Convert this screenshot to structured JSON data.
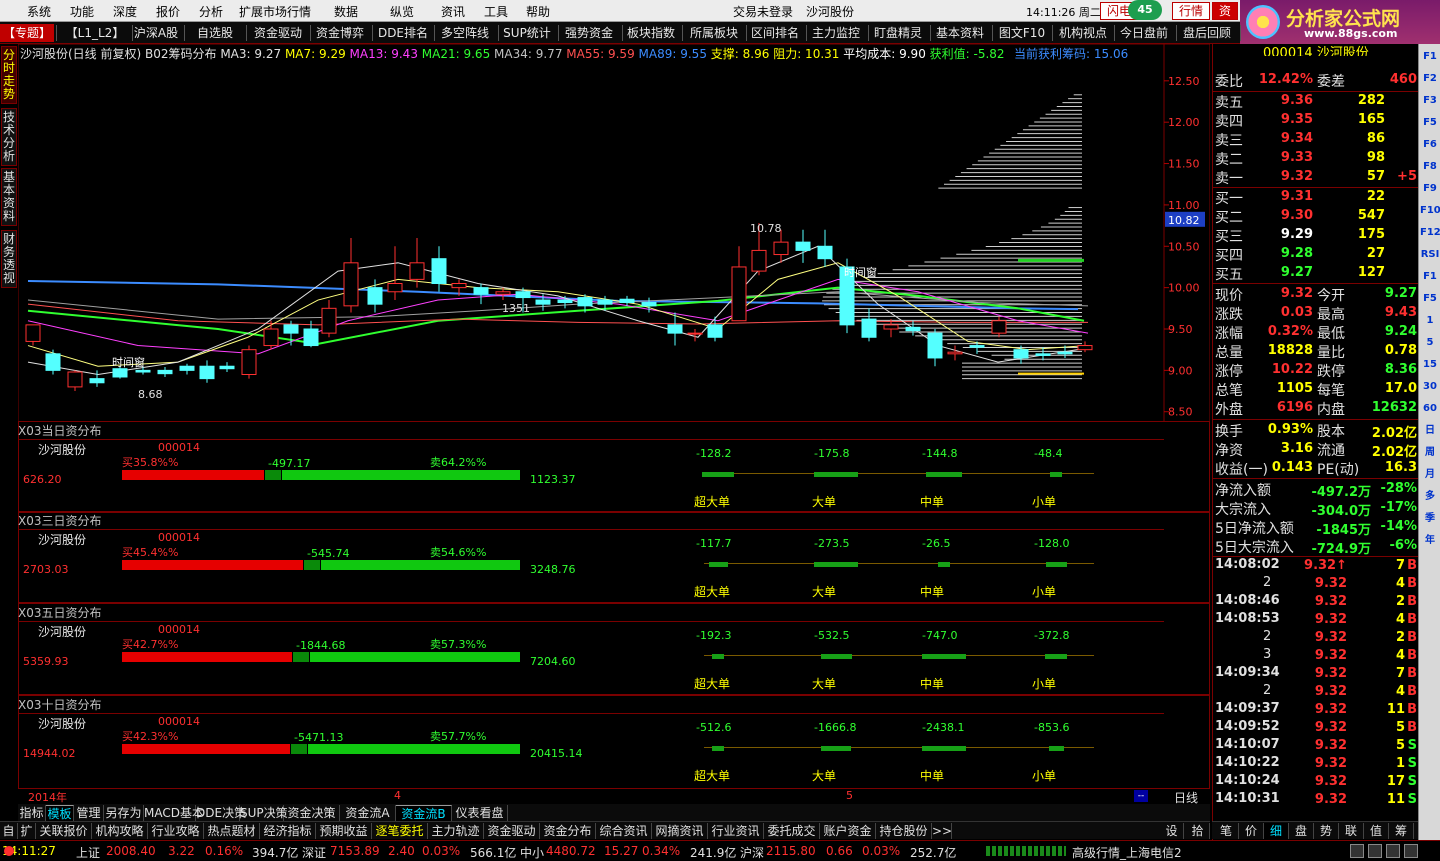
{
  "menu": {
    "items": [
      "系统",
      "功能",
      "深度",
      "报价",
      "分析",
      "扩展市场行情",
      "数据",
      "纵览",
      "资讯",
      "工具",
      "帮助"
    ],
    "login": "交易未登录",
    "stock": "沙河股份",
    "time": "14:11:26 周二",
    "btn_flash": "闪电",
    "badge": "45",
    "btn_quote": "行情",
    "btn_trade": "资"
  },
  "logo": {
    "t1": "分析家公式网",
    "t2": "www.88gs.com"
  },
  "toolbar": {
    "items": [
      "【专题】",
      "【L1_L2】",
      "沪深A股",
      "自选股",
      "资金驱动",
      "资金博弈",
      "DDE排名",
      "多空阵线",
      "SUP统计",
      "强势资金",
      "板块指数",
      "所属板块",
      "区间排名",
      "主力监控",
      "盯盘精灵",
      "基本资料",
      "图文F10",
      "机构视点",
      "今日盘前",
      "盘后回顾"
    ]
  },
  "vtabs": [
    "分时走势",
    "技术分析",
    "基本资料",
    "财务透视"
  ],
  "chart_header": {
    "name": "沙河股份(日线 前复权) B02筹码分布",
    "ma3": "MA3: 9.27",
    "ma7": "MA7: 9.29",
    "ma13": "MA13: 9.43",
    "ma21": "MA21: 9.65",
    "ma34": "MA34: 9.77",
    "ma55": "MA55: 9.59",
    "ma89": "MA89: 9.55",
    "support": "支撑: 8.96",
    "resist": "阻力: 10.31",
    "avgcost": "平均成本: 9.90",
    "profit": "获利值: -5.82",
    "cur_profit": "当前获利筹码: 15.06"
  },
  "chart_labels": {
    "high": "10.78",
    "low": "8.68",
    "mid": "1351",
    "window1": "时间窗",
    "window2": "时间窗",
    "price_tag": "10.82"
  },
  "chart_data": {
    "type": "candlestick",
    "y_ticks": [
      12.5,
      12.0,
      11.5,
      11.0,
      10.5,
      10.0,
      9.5,
      9.0,
      8.5
    ],
    "y_tick_labels": [
      "12.50",
      "12.00",
      "11.50",
      "11.00",
      "10.50",
      "10.00",
      "9.50",
      "9.00",
      "8.50"
    ],
    "ylim": [
      8.4,
      12.8
    ],
    "x_labels": [
      "2014年",
      "4",
      "5",
      "日线"
    ]
  },
  "sections": [
    {
      "title": "X03当日资分布",
      "name": "沙河股份",
      "code": "000014",
      "buy_pct": "买35.8%%",
      "sell_pct": "卖64.2%%",
      "net": "-497.17",
      "left": "626.20",
      "right": "1123.37",
      "buy_frac": 0.358,
      "cat_vals": [
        "-128.2",
        "-175.8",
        "-144.8",
        "-48.4"
      ],
      "cat_labels": [
        "超大单",
        "大单",
        "中单",
        "小单"
      ]
    },
    {
      "title": "X03三日资分布",
      "name": "沙河股份",
      "code": "000014",
      "buy_pct": "买45.4%%",
      "sell_pct": "卖54.6%%",
      "net": "-545.74",
      "left": "2703.03",
      "right": "3248.76",
      "buy_frac": 0.454,
      "cat_vals": [
        "-117.7",
        "-273.5",
        "-26.5",
        "-128.0"
      ],
      "cat_labels": [
        "超大单",
        "大单",
        "中单",
        "小单"
      ]
    },
    {
      "title": "X03五日资分布",
      "name": "沙河股份",
      "code": "000014",
      "buy_pct": "买42.7%%",
      "sell_pct": "卖57.3%%",
      "net": "-1844.68",
      "left": "5359.93",
      "right": "7204.60",
      "buy_frac": 0.427,
      "cat_vals": [
        "-192.3",
        "-532.5",
        "-747.0",
        "-372.8"
      ],
      "cat_labels": [
        "超大单",
        "大单",
        "中单",
        "小单"
      ]
    },
    {
      "title": "X03十日资分布",
      "name": "沙河股份",
      "code": "000014",
      "buy_pct": "买42.3%%",
      "sell_pct": "卖57.7%%",
      "net": "-5471.13",
      "left": "14944.02",
      "right": "20415.14",
      "buy_frac": 0.423,
      "cat_vals": [
        "-512.6",
        "-1666.8",
        "-2438.1",
        "-853.6"
      ],
      "cat_labels": [
        "超大单",
        "大单",
        "中单",
        "小单"
      ]
    }
  ],
  "tabs1": [
    "指标",
    "模板",
    "管理",
    "另存为",
    "MACD基本",
    "DDE决策",
    "SUP决策",
    "资金决策",
    "资金流A",
    "资金流B",
    "仪表看盘"
  ],
  "tabs2": [
    "自",
    "扩",
    "关联报价",
    "机构攻略",
    "行业攻略",
    "热点题材",
    "经济指标",
    "预期收益",
    "逐笔委托",
    "主力轨迹",
    "资金驱动",
    "资金分布",
    "综合资讯",
    "网摘资讯",
    "行业资讯",
    "委托成交",
    "账户资金",
    "持仓股份",
    ">>",
    "设",
    "拾"
  ],
  "right": {
    "header": "000014 沙河股份",
    "ratio": {
      "l1": "委比",
      "v1": "12.42%",
      "l2": "委差",
      "v2": "460"
    },
    "sells": [
      {
        "l": "卖五",
        "p": "9.36",
        "v": "282"
      },
      {
        "l": "卖四",
        "p": "9.35",
        "v": "165"
      },
      {
        "l": "卖三",
        "p": "9.34",
        "v": "86"
      },
      {
        "l": "卖二",
        "p": "9.33",
        "v": "98"
      },
      {
        "l": "卖一",
        "p": "9.32",
        "v": "57",
        "x": "+5"
      }
    ],
    "buys": [
      {
        "l": "买一",
        "p": "9.31",
        "v": "22"
      },
      {
        "l": "买二",
        "p": "9.30",
        "v": "547"
      },
      {
        "l": "买三",
        "p": "9.29",
        "v": "175"
      },
      {
        "l": "买四",
        "p": "9.28",
        "v": "27"
      },
      {
        "l": "买五",
        "p": "9.27",
        "v": "127"
      }
    ],
    "stats": [
      {
        "l1": "现价",
        "v1": "9.32",
        "l2": "今开",
        "v2": "9.27"
      },
      {
        "l1": "涨跌",
        "v1": "0.03",
        "l2": "最高",
        "v2": "9.43"
      },
      {
        "l1": "涨幅",
        "v1": "0.32%",
        "l2": "最低",
        "v2": "9.24"
      },
      {
        "l1": "总量",
        "v1": "18828",
        "l2": "量比",
        "v2": "0.78"
      },
      {
        "l1": "涨停",
        "v1": "10.22",
        "l2": "跌停",
        "v2": "8.36"
      },
      {
        "l1": "总笔",
        "v1": "1105",
        "l2": "每笔",
        "v2": "17.0"
      },
      {
        "l1": "外盘",
        "v1": "6196",
        "l2": "内盘",
        "v2": "12632"
      }
    ],
    "stats2": [
      {
        "l1": "换手",
        "v1": "0.93%",
        "l2": "股本",
        "v2": "2.02亿"
      },
      {
        "l1": "净资",
        "v1": "3.16",
        "l2": "流通",
        "v2": "2.02亿"
      },
      {
        "l1": "收益(一)",
        "v1": "0.143",
        "l2": "PE(动)",
        "v2": "16.3"
      }
    ],
    "flows": [
      {
        "l": "净流入额",
        "v": "-497.2万",
        "p": "-28%"
      },
      {
        "l": "大宗流入",
        "v": "-304.0万",
        "p": "-17%"
      },
      {
        "l": "5日净流入额",
        "v": "-1845万",
        "p": "-14%"
      },
      {
        "l": "5日大宗流入",
        "v": "-724.9万",
        "p": "-6%"
      }
    ],
    "ticks": [
      {
        "t": "14:08:02",
        "p": "9.32↑",
        "v": "7",
        "s": "B"
      },
      {
        "t": "2",
        "p": "9.32",
        "v": "4",
        "s": "B"
      },
      {
        "t": "14:08:46",
        "p": "9.32",
        "v": "2",
        "s": "B"
      },
      {
        "t": "14:08:53",
        "p": "9.32",
        "v": "4",
        "s": "B"
      },
      {
        "t": "2",
        "p": "9.32",
        "v": "2",
        "s": "B"
      },
      {
        "t": "3",
        "p": "9.32",
        "v": "4",
        "s": "B"
      },
      {
        "t": "14:09:34",
        "p": "9.32",
        "v": "7",
        "s": "B"
      },
      {
        "t": "2",
        "p": "9.32",
        "v": "4",
        "s": "B"
      },
      {
        "t": "14:09:37",
        "p": "9.32",
        "v": "11",
        "s": "B"
      },
      {
        "t": "14:09:52",
        "p": "9.32",
        "v": "5",
        "s": "B"
      },
      {
        "t": "14:10:07",
        "p": "9.32",
        "v": "5",
        "s": "S"
      },
      {
        "t": "14:10:22",
        "p": "9.32",
        "v": "1",
        "s": "S"
      },
      {
        "t": "14:10:24",
        "p": "9.32",
        "v": "17",
        "s": "S"
      },
      {
        "t": "14:10:31",
        "p": "9.32",
        "v": "11",
        "s": "S"
      }
    ]
  },
  "rtabs": [
    "笔",
    "价",
    "细",
    "盘",
    "势",
    "联",
    "值",
    "筹"
  ],
  "rightstrip": [
    "F1",
    "F2",
    "F3",
    "F5",
    "F6",
    "F8",
    "F9",
    "F10",
    "F12",
    "RSI",
    "F1",
    "F5",
    "1",
    "5",
    "15",
    "30",
    "60",
    "日",
    "周",
    "月",
    "多",
    "季",
    "年"
  ],
  "status": {
    "time": "14:11:27",
    "sh": "上证",
    "sh_v": "2008.40",
    "sh_c": "3.22",
    "sh_p": "0.16%",
    "sh_a": "394.7亿",
    "sz": "深证",
    "sz_v": "7153.89",
    "sz_c": "2.40",
    "sz_p": "0.03%",
    "sz_a": "566.1亿",
    "zx": "中小",
    "zx_v": "4480.72",
    "zx_c": "15.27",
    "zx_p": "0.34%",
    "zx_a": "241.9亿",
    "hs": "沪深",
    "hs_v": "2115.80",
    "hs_c": "0.66",
    "hs_p": "0.03%",
    "hs_a": "252.7亿",
    "right": "高级行情_上海电信2"
  }
}
